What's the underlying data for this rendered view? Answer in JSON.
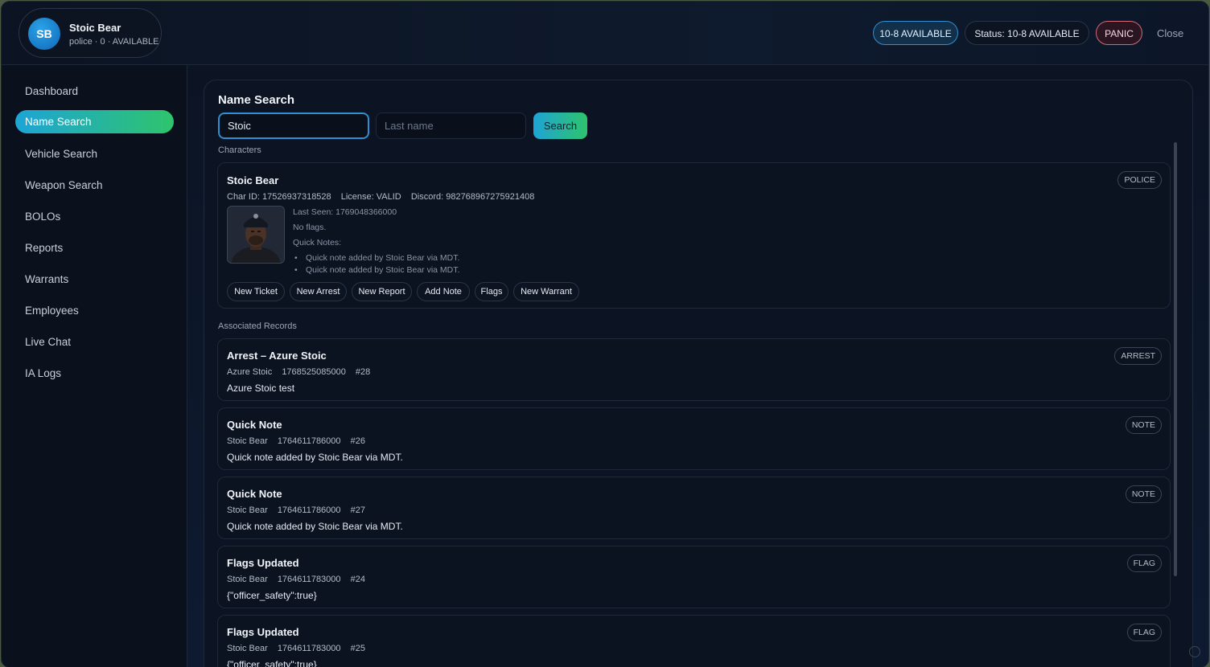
{
  "header": {
    "avatar_initials": "SB",
    "user_name": "Stoic Bear",
    "user_sub": "police · 0 · AVAILABLE",
    "available_pill": "10-8 AVAILABLE",
    "status_pill": "Status: 10-8 AVAILABLE",
    "panic_label": "PANIC",
    "close_label": "Close"
  },
  "sidebar": {
    "items": [
      {
        "label": "Dashboard"
      },
      {
        "label": "Name Search"
      },
      {
        "label": "Vehicle Search"
      },
      {
        "label": "Weapon Search"
      },
      {
        "label": "BOLOs"
      },
      {
        "label": "Reports"
      },
      {
        "label": "Warrants"
      },
      {
        "label": "Employees"
      },
      {
        "label": "Live Chat"
      },
      {
        "label": "IA Logs"
      }
    ],
    "active": "Name Search"
  },
  "search": {
    "title": "Name Search",
    "first_value": "Stoic",
    "last_placeholder": "Last name",
    "button_label": "Search"
  },
  "characters": {
    "label": "Characters",
    "card": {
      "name": "Stoic Bear",
      "tag": "POLICE",
      "char_id": "Char ID: 17526937318528",
      "license": "License: VALID",
      "discord": "Discord: 982768967275921408",
      "last_seen": "Last Seen: 1769048366000",
      "flags": "No flags.",
      "quick_notes_label": "Quick Notes:",
      "quick_notes": [
        "Quick note added by Stoic Bear via MDT.",
        "Quick note added by Stoic Bear via MDT."
      ],
      "actions": [
        "New Ticket",
        "New Arrest",
        "New Report",
        "Add Note",
        "Flags",
        "New Warrant"
      ]
    }
  },
  "records": {
    "label": "Associated Records",
    "items": [
      {
        "title": "Arrest – Azure Stoic",
        "tag": "ARREST",
        "who": "Azure Stoic",
        "time": "1768525085000",
        "num": "#28",
        "body": "Azure Stoic test"
      },
      {
        "title": "Quick Note",
        "tag": "NOTE",
        "who": "Stoic Bear",
        "time": "1764611786000",
        "num": "#26",
        "body": "Quick note added by Stoic Bear via MDT."
      },
      {
        "title": "Quick Note",
        "tag": "NOTE",
        "who": "Stoic Bear",
        "time": "1764611786000",
        "num": "#27",
        "body": "Quick note added by Stoic Bear via MDT."
      },
      {
        "title": "Flags Updated",
        "tag": "FLAG",
        "who": "Stoic Bear",
        "time": "1764611783000",
        "num": "#24",
        "body": "{\"officer_safety\":true}"
      },
      {
        "title": "Flags Updated",
        "tag": "FLAG",
        "who": "Stoic Bear",
        "time": "1764611783000",
        "num": "#25",
        "body": "{\"officer_safety\":true}"
      }
    ]
  },
  "colors": {
    "accent_start": "#1ea4d6",
    "accent_end": "#2ec46c",
    "panic": "#d06a78",
    "background": "#0b1220"
  }
}
